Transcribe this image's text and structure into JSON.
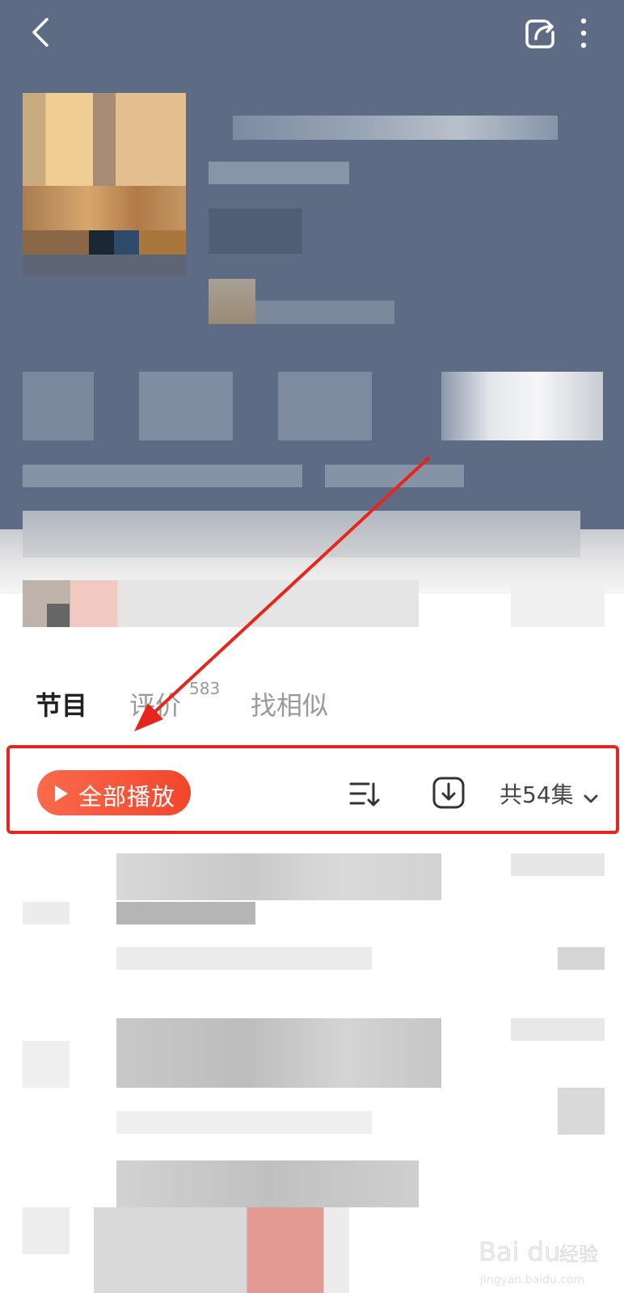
{
  "tabs": [
    {
      "label": "节目"
    },
    {
      "label": "评价",
      "count": "583"
    },
    {
      "label": "找相似"
    }
  ],
  "toolbar": {
    "play_all_label": "全部播放",
    "episode_count_label": "共54集"
  },
  "icons": [
    "back-icon",
    "share-icon",
    "more-icon",
    "play-icon",
    "sort-icon",
    "download-icon",
    "chevron-down-icon"
  ],
  "colors": {
    "header_background": "#5d6c84",
    "accent": "#f2462c",
    "annotation": "#e8251c"
  },
  "watermark": {
    "brand": "Bai du",
    "site_label": "经验",
    "url": "jingyan.baidu.com"
  }
}
